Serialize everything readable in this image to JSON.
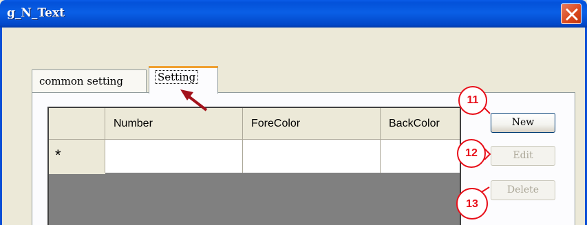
{
  "window": {
    "title": "g_N_Text"
  },
  "tabs": [
    {
      "label": "common setting"
    },
    {
      "label": "Setting"
    }
  ],
  "grid": {
    "columns": [
      "Number",
      "ForeColor",
      "BackColor"
    ],
    "new_row_marker": "*"
  },
  "buttons": {
    "new": "New",
    "edit": "Edit",
    "delete": "Delete"
  },
  "callouts": {
    "new": "11",
    "edit": "12",
    "delete": "13"
  },
  "colors": {
    "callout": "#e8101a",
    "arrow": "#a3121c",
    "active_tab_accent": "#f0a030",
    "titlebar": "#0351d9"
  }
}
